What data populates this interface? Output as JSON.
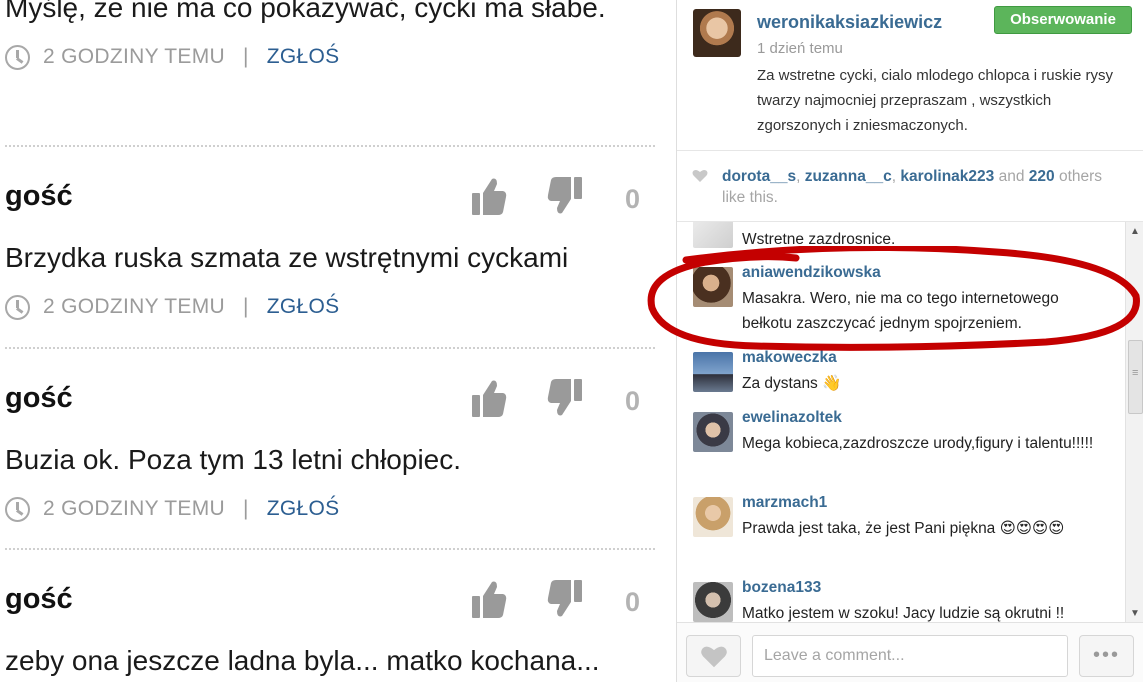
{
  "left_comments": [
    {
      "author": "",
      "score": "",
      "text": "Myślę, że nie ma co pokazywać, cycki ma słabe.",
      "time": "2 GODZINY TEMU",
      "report": "ZGŁOŚ"
    },
    {
      "author": "gość",
      "score": "0",
      "text": "Brzydka ruska szmata ze wstrętnymi cyckami",
      "time": "2 GODZINY TEMU",
      "report": "ZGŁOŚ"
    },
    {
      "author": "gość",
      "score": "0",
      "text": "Buzia ok. Poza tym 13 letni chłopiec.",
      "time": "2 GODZINY TEMU",
      "report": "ZGŁOŚ"
    },
    {
      "author": "gość",
      "score": "0",
      "text": "zeby ona jeszcze ladna byla... matko kochana...",
      "time": "",
      "report": ""
    }
  ],
  "separator": "|",
  "post": {
    "username": "weronikaksiazkiewicz",
    "follow_label": "Obserwowanie",
    "time": "1 dzień temu",
    "caption": "Za wstretne cycki, cialo mlodego chlopca i ruskie rysy twarzy najmocniej przepraszam , wszystkich zgorszonych i zniesmaczonych."
  },
  "likes": {
    "users": [
      "dorota__s",
      "zuzanna__c",
      "karolinak223"
    ],
    "sep": ", ",
    "and_word": " and ",
    "count": "220",
    "suffix": "others like this."
  },
  "comments": [
    {
      "username": "",
      "text": "Wstretne zazdrosnice."
    },
    {
      "username": "aniawendzikowska",
      "text": "Masakra. Wero, nie ma co tego internetowego bełkotu zaszczycać jednym spojrzeniem."
    },
    {
      "username": "makoweczka",
      "text": "Za dystans 👋"
    },
    {
      "username": "ewelinazoltek",
      "text": "Mega kobieca,zazdroszcze urody,figury i talentu!!!!!"
    },
    {
      "username": "marzmach1",
      "text": "Prawda jest taka, że jest Pani piękna 😍😍😍😍"
    },
    {
      "username": "bozena133",
      "text": "Matko jestem w szoku! Jacy ludzie są okrutni !!"
    }
  ],
  "input": {
    "placeholder": "Leave a comment..."
  },
  "more_label": "•••",
  "colors": {
    "link": "#3a6b93",
    "follow": "#5cb55b",
    "annotation": "#c40000",
    "report_link": "#2c5e91"
  }
}
